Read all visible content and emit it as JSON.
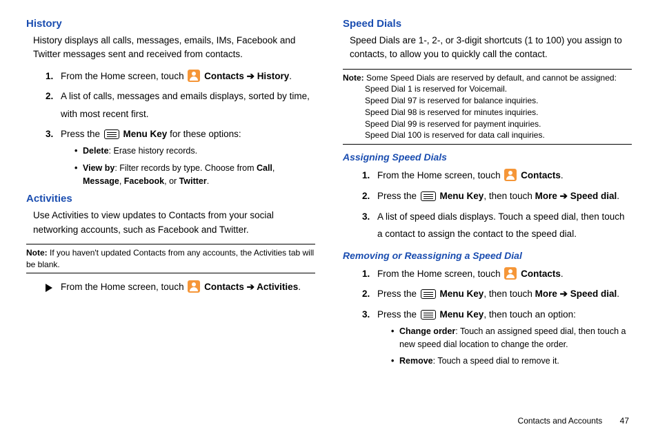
{
  "left": {
    "history": {
      "title": "History",
      "intro": "History displays all calls, messages, emails, IMs, Facebook and Twitter messages sent and received from contacts.",
      "step1_a": "From the Home screen, touch ",
      "step1_b": "Contacts",
      "step1_c": "History",
      "step2": "A list of calls, messages and emails displays, sorted by time, with most recent first.",
      "step3_a": "Press the ",
      "step3_b": "Menu Key",
      "step3_c": " for these options:",
      "b1_a": "Delete",
      "b1_b": ": Erase history records.",
      "b2_a": "View by",
      "b2_b": ": Filter records by type. Choose from ",
      "b2_c": "Call",
      "b2_d": "Message",
      "b2_e": "Facebook",
      "b2_f": "Twitter"
    },
    "activities": {
      "title": "Activities",
      "intro": "Use Activities to view updates to Contacts from your social networking accounts, such as Facebook and Twitter.",
      "note_label": "Note:",
      "note_text": "If you haven't updated Contacts from any accounts, the Activities tab will be blank.",
      "step_a": "From the Home screen, touch ",
      "step_b": "Contacts",
      "step_c": "Activities"
    }
  },
  "right": {
    "speed": {
      "title": "Speed Dials",
      "intro": "Speed Dials are 1-, 2-, or 3-digit shortcuts (1 to 100) you assign to contacts, to allow you to quickly call the contact.",
      "note_label": "Note:",
      "note1": "Some Speed Dials are reserved by default, and cannot be assigned:",
      "note2": "Speed Dial 1 is reserved for Voicemail.",
      "note3": "Speed Dial 97 is reserved for balance inquiries.",
      "note4": "Speed Dial 98 is reserved for minutes inquiries.",
      "note5": "Speed Dial 99 is reserved for payment inquiries.",
      "note6": "Speed Dial 100 is reserved for data call inquiries."
    },
    "assigning": {
      "title": "Assigning Speed Dials",
      "s1_a": "From the Home screen, touch ",
      "s1_b": "Contacts",
      "s2_a": "Press the ",
      "s2_b": "Menu Key",
      "s2_c": ", then touch ",
      "s2_d": "More",
      "s2_e": "Speed dial",
      "s3": "A list of speed dials displays. Touch a speed dial, then touch a contact to assign the contact to the speed dial."
    },
    "removing": {
      "title": "Removing or Reassigning a Speed Dial",
      "s1_a": "From the Home screen, touch ",
      "s1_b": "Contacts",
      "s2_a": "Press the ",
      "s2_b": "Menu Key",
      "s2_c": ", then touch ",
      "s2_d": "More",
      "s2_e": "Speed dial",
      "s3_a": "Press the ",
      "s3_b": "Menu Key",
      "s3_c": ", then touch an option:",
      "b1_a": "Change order",
      "b1_b": ": Touch an assigned speed dial, then touch a new speed dial location to change the order.",
      "b2_a": "Remove",
      "b2_b": ": Touch a speed dial to remove it."
    }
  },
  "footer": {
    "section": "Contacts and Accounts",
    "page": "47"
  },
  "glue": {
    "arrow": " ➔ ",
    "comma": ", ",
    "or": ", or ",
    "period": "."
  }
}
